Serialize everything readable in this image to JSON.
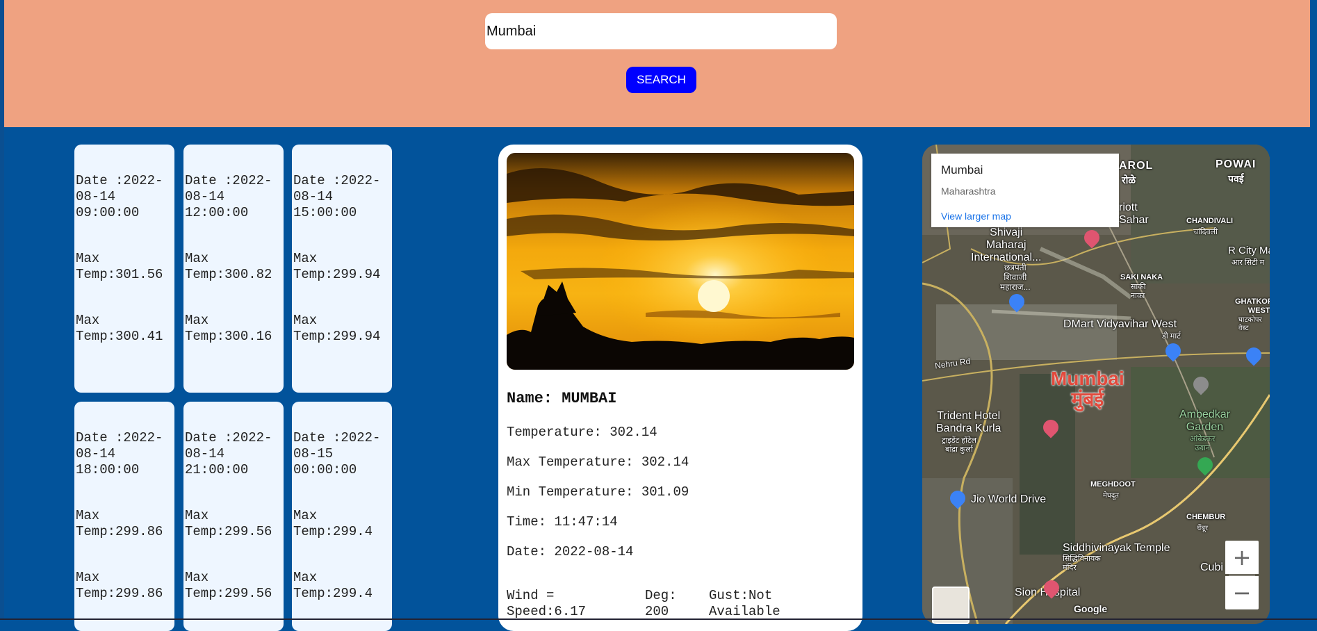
{
  "search": {
    "value": "Mumbai",
    "button_label": "SEARCH"
  },
  "forecasts": [
    {
      "date": "Date :2022-\n08-14\n09:00:00",
      "max1": "Max\nTemp:301.56",
      "max2": "Max\nTemp:300.41"
    },
    {
      "date": "Date :2022-\n08-14\n12:00:00",
      "max1": "Max\nTemp:300.82",
      "max2": "Max\nTemp:300.16"
    },
    {
      "date": "Date :2022-\n08-14\n15:00:00",
      "max1": "Max\nTemp:299.94",
      "max2": "Max\nTemp:299.94"
    },
    {
      "date": "Date :2022-\n08-14\n18:00:00",
      "max1": "Max\nTemp:299.86",
      "max2": "Max\nTemp:299.86"
    },
    {
      "date": "Date :2022-\n08-14\n21:00:00",
      "max1": "Max\nTemp:299.56",
      "max2": "Max\nTemp:299.56"
    },
    {
      "date": "Date :2022-\n08-15\n00:00:00",
      "max1": "Max\nTemp:299.4",
      "max2": "Max\nTemp:299.4"
    }
  ],
  "current": {
    "name": "Name: MUMBAI",
    "temperature": "Temperature: 302.14",
    "max_temperature": "Max Temperature: 302.14",
    "min_temperature": "Min Temperature: 301.09",
    "time": "Time: 11:47:14",
    "date": "Date: 2022-08-14",
    "wind_speed": "Wind =\nSpeed:6.17",
    "wind_deg": "Deg:\n200",
    "wind_gust": "Gust:Not\nAvailable"
  },
  "map": {
    "info_title": "Mumbai",
    "info_subtitle": "Maharashtra",
    "info_link": "View larger map",
    "city_label": "Mumbai",
    "city_label_local": "मुंबई",
    "zoom_in": "+",
    "zoom_out": "−",
    "places": {
      "powai": "POWAI",
      "powai_local": "पवई",
      "marol": "AROL",
      "marol_local": "रोळे",
      "airport": "Shivaji\nMaharaj\nInternational...",
      "airport_local": "छत्रपती\nशिवाजी\nमहाराज...",
      "sahar": "riott\nSahar",
      "chandivali": "CHANDIVALI",
      "chandivali_local": "चांदिवली",
      "rcity": "R City Ma",
      "rcity_local": "आर सिटी म",
      "sakinaka": "SAKI NAKA",
      "sakinaka_local": "साकी\nनाका",
      "ghatkopar": "GHATKOPAR\nWEST",
      "ghatkopar_local": "घाटकोपर\nवेस्ट",
      "dmart": "DMart Vidyavihar West",
      "dmart_local": "डी मार्ट",
      "nehru": "Nehru Rd",
      "trident": "Trident Hotel\nBandra Kurla",
      "trident_local": "ट्राइडेंट हॉटेल\nबांद्रा कुर्ला",
      "ambedkar": "Ambedkar\nGarden",
      "ambedkar_local": "आंबेडकर\nउद्यान",
      "meghdoot": "MEGHDOOT",
      "meghdoot_local": "मेघदूत",
      "jio": "Jio World Drive",
      "chembur": "CHEMBUR",
      "chembur_local": "चेंबूर",
      "siddhi": "Siddhivinayak Temple",
      "siddhi_local": "सिद्धिविनायक\nमंदिर",
      "sion": "Sion Hospital",
      "cubi": "Cubi",
      "google": "Google"
    }
  },
  "colors": {
    "page_bg": "#02539b",
    "header_bg": "#efa281",
    "button_bg": "#0000ff",
    "card_bg": "#eef6ff"
  }
}
